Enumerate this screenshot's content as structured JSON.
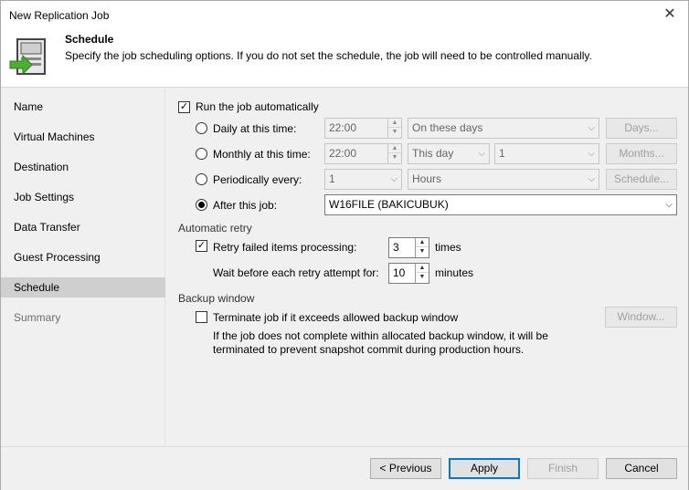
{
  "window": {
    "title": "New Replication Job",
    "close_glyph": "✕"
  },
  "header": {
    "title": "Schedule",
    "description": "Specify the job scheduling options. If you do not set the schedule, the job will need to be controlled manually."
  },
  "sidebar": {
    "items": [
      {
        "label": "Name"
      },
      {
        "label": "Virtual Machines"
      },
      {
        "label": "Destination"
      },
      {
        "label": "Job Settings"
      },
      {
        "label": "Data Transfer"
      },
      {
        "label": "Guest Processing"
      },
      {
        "label": "Schedule"
      },
      {
        "label": "Summary"
      }
    ],
    "active": "Schedule"
  },
  "schedule": {
    "run_auto_label": "Run the job automatically",
    "run_auto_checked": true,
    "daily": {
      "label": "Daily at this time:",
      "time": "22:00",
      "days_select": "On these days",
      "button": "Days..."
    },
    "monthly": {
      "label": "Monthly at this time:",
      "time": "22:00",
      "day_select": "This day",
      "num_select": "1",
      "button": "Months..."
    },
    "periodic": {
      "label": "Periodically every:",
      "value": "1",
      "unit": "Hours",
      "button": "Schedule..."
    },
    "after": {
      "label": "After this job:",
      "value": "W16FILE (BAKICUBUK)",
      "selected": true
    }
  },
  "retry": {
    "section": "Automatic retry",
    "retry_label": "Retry failed items processing:",
    "retry_checked": true,
    "retry_count": "3",
    "retry_unit": "times",
    "wait_label": "Wait before each retry attempt for:",
    "wait_value": "10",
    "wait_unit": "minutes"
  },
  "backup_window": {
    "section": "Backup window",
    "terminate_label": "Terminate job if it exceeds allowed backup window",
    "terminate_checked": false,
    "button": "Window...",
    "note_line1": "If the job does not complete within allocated backup window, it will be",
    "note_line2": "terminated to prevent snapshot commit during production hours."
  },
  "footer": {
    "previous": "< Previous",
    "apply": "Apply",
    "finish": "Finish",
    "cancel": "Cancel"
  },
  "icons": {
    "check": "✓",
    "up": "▲",
    "down": "▼",
    "dropdown": "⌵"
  },
  "colors": {
    "accent_blue": "#0078d7",
    "green_arrow": "#4caf2f"
  }
}
